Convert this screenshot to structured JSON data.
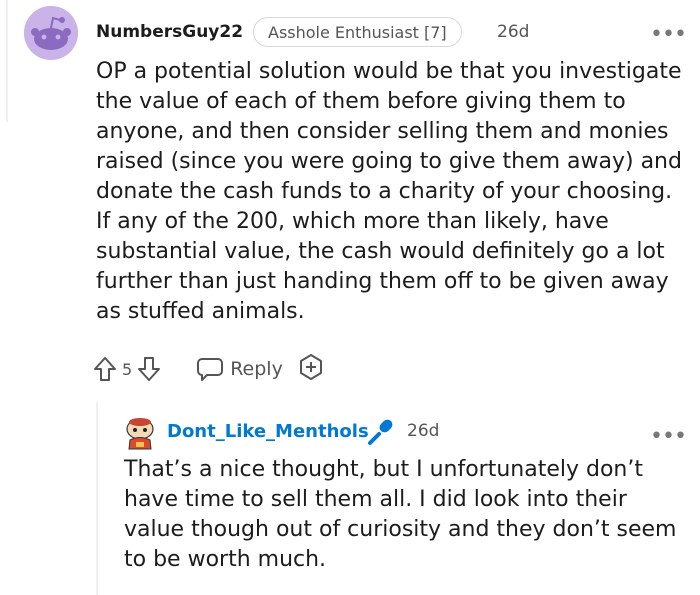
{
  "comment": {
    "username": "NumbersGuy22",
    "flair": "Asshole Enthusiast [7]",
    "age": "26d",
    "more": "•••",
    "body": "OP a potential solution would be that you investigate the value of each of them before giving them to anyone, and then consider selling them and monies raised (since you were going to give them away) and donate the cash funds to a charity of your choosing. If any of the 200, which more than likely, have substantial value, the cash would definitely go a lot further than just handing them off to be given away as stuffed animals.",
    "vote_count": "5",
    "reply_label": "Reply",
    "avatar_color": "#c9b3e8"
  },
  "reply": {
    "username": "Dont_Like_Menthols",
    "age": "26d",
    "more": "•••",
    "body": "That’s a nice thought, but I unfortunately don’t have time to sell them all. I did look into their value though out of curiosity and they don’t seem to be worth much.",
    "username_color": "#0079d3",
    "flair_icon": "microphone-icon"
  }
}
